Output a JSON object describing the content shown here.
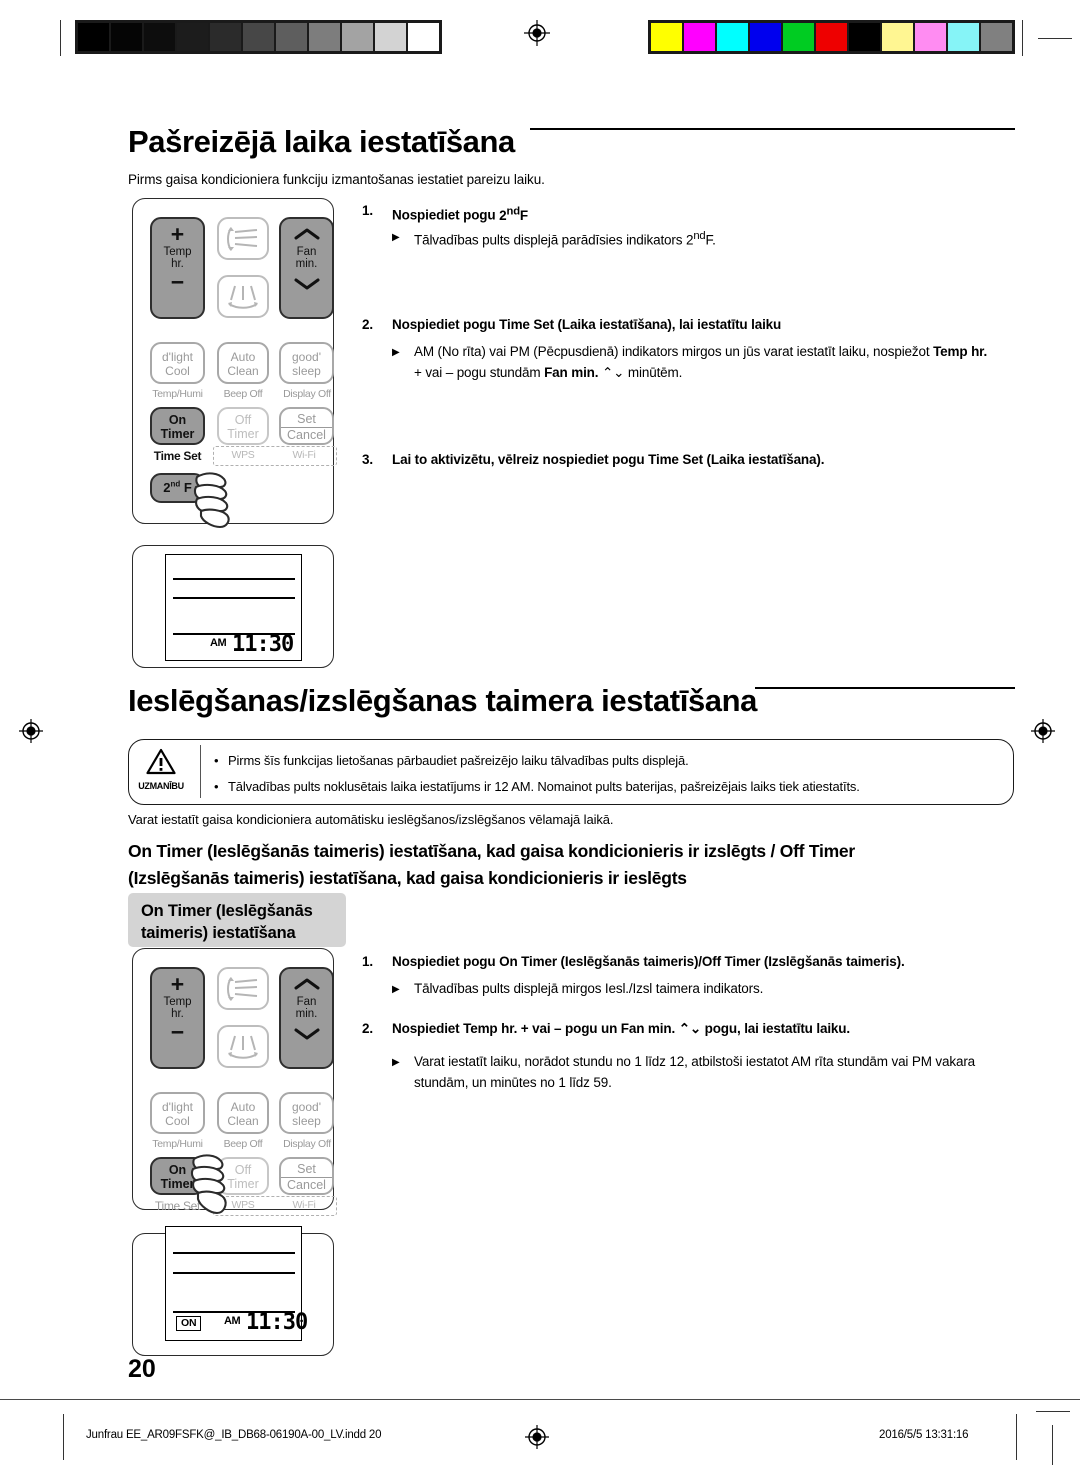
{
  "page": {
    "number": "20",
    "colorbar_gray": [
      "#000000",
      "#050505",
      "#0d0d0d",
      "#1c1c1c",
      "#2b2b2b",
      "#474747",
      "#5e5e5e",
      "#7d7d7d",
      "#a3a3a3",
      "#d3d3d3",
      "#ffffff"
    ],
    "colorbar_color": [
      "#ffff00",
      "#ff00ff",
      "#00ffff",
      "#0000ee",
      "#00cc22",
      "#ee0000",
      "#000000",
      "#fff692",
      "#ff8cf2",
      "#86f4f7",
      "#808080"
    ]
  },
  "section1": {
    "title": "Pašreizējā laika iestatīšana",
    "intro": "Pirms gaisa kondicioniera funkciju izmantošanas iestatiet pareizu laiku.",
    "steps": [
      {
        "num": "1.",
        "text_html": "Nospiediet pogu <b>2<sup>nd</sup>F</b>",
        "bullets": [
          "Tālvadības pults displejā parādīsies indikators 2<sup>nd</sup>F."
        ]
      },
      {
        "num": "2.",
        "text_html": "Nospiediet pogu <b>Time Set (Laika iestatīšana)</b>, lai iestatītu laiku",
        "bullets": [
          "AM (No rīta) vai PM (Pēcpusdienā) indikators mirgos un jūs varat iestatīt laiku, nospiežot <b>Temp hr.</b> + vai &ndash; pogu stundām <b>Fan min.</b> ⌃⌄ minūtēm."
        ]
      },
      {
        "num": "3.",
        "text_html": "Lai to aktivizētu, vēlreiz nospiediet pogu <b>Time Set (Laika iestatīšana)</b>.",
        "bullets": []
      }
    ]
  },
  "section2": {
    "title": "Ieslēgšanas/izslēgšanas taimera iestatīšana",
    "warning": {
      "icon_label": "UZMANĪBU",
      "items": [
        "Pirms šīs funkcijas lietošanas pārbaudiet pašreizējo laiku tālvadības pults displejā.",
        "Tālvadības pults noklusētais laika iestatījums ir 12 AM. Nomainot pults baterijas, pašreizējais laiks tiek atiestatīts."
      ]
    },
    "body": "Varat iestatīt gaisa kondicioniera automātisku ieslēgšanos/izslēgšanos vēlamajā laikā.",
    "subheading_line1": "On Timer (Ieslēgšanās taimeris) iestatīšana, kad gaisa kondicionieris ir izslēgts / Off Timer",
    "subheading_line2": "(Izslēgšanās taimeris) iestatīšana, kad gaisa kondicionieris ir ieslēgts",
    "tag_line1": "On Timer (Ieslēgšanās",
    "tag_line2": "taimeris) iestatīšana",
    "steps": [
      {
        "num": "1.",
        "text_html": "Nospiediet pogu <b>On Timer (Ieslēgšanās taimeris)/Off Timer (Izslēgšanās taimeris)</b>.",
        "bullets": [
          "Tālvadības pults displejā mirgos Iesl./Izsl taimera indikators."
        ]
      },
      {
        "num": "2.",
        "text_html": "Nospiediet <b>Temp hr.</b> + vai &ndash; pogu un <b>Fan min.</b> ⌃⌄ pogu, lai iestatītu laiku.",
        "bullets": [
          "Varat iestatīt laiku, norādot stundu no 1 līdz 12, atbilstoši iestatot AM rīta stundām vai PM vakara stundām, un minūtes no 1 līdz 59."
        ]
      }
    ]
  },
  "remote": {
    "temp_plus": "+",
    "temp_label_l1": "Temp",
    "temp_label_l2": "hr.",
    "temp_minus": "−",
    "fan_label_l1": "Fan",
    "fan_label_l2": "min.",
    "dlight_l1": "d'light",
    "dlight_l2": "Cool",
    "autoclean_l1": "Auto",
    "autoclean_l2": "Clean",
    "goodsleep_l1": "good'",
    "goodsleep_l2": "sleep",
    "temphumi": "Temp/Humi",
    "beepoff": "Beep Off",
    "displayoff": "Display Off",
    "ontimer_l1": "On",
    "ontimer_l2": "Timer",
    "offtimer_l1": "Off",
    "offtimer_l2": "Timer",
    "set": "Set",
    "cancel": "Cancel",
    "timeset": "Time Set",
    "wps": "WPS",
    "wifi": "Wi-Fi",
    "secondf": "2ⁿᵈ F"
  },
  "lcd_top": {
    "ampm": "AM",
    "time": "11:30"
  },
  "lcd_bottom": {
    "on_badge": "ON",
    "ampm": "AM",
    "time": "11:30"
  },
  "footer": {
    "left": "Junfrau EE_AR09FSFK@_IB_DB68-06190A-00_LV.indd   20",
    "right": "2016/5/5   13:31:16"
  }
}
